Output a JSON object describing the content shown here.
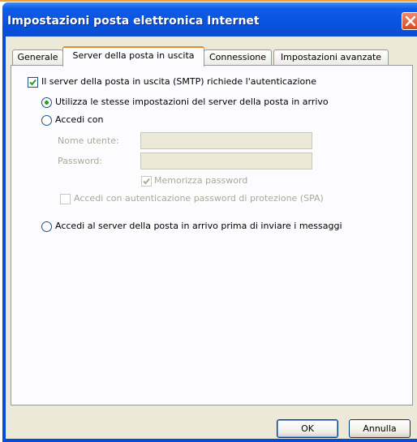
{
  "window": {
    "title": "Impostazioni posta elettronica Internet"
  },
  "tabs": [
    {
      "label": "Generale",
      "active": false
    },
    {
      "label": "Server della posta in uscita",
      "active": true
    },
    {
      "label": "Connessione",
      "active": false
    },
    {
      "label": "Impostazioni avanzate",
      "active": false
    }
  ],
  "outgoing": {
    "smtp_auth_label": "Il server della posta in uscita (SMTP) richiede l'autenticazione",
    "smtp_auth_checked": true,
    "same_settings_label": "Utilizza le stesse impostazioni del server della posta in arrivo",
    "same_settings_selected": true,
    "login_with_label": "Accedi con",
    "login_with_selected": false,
    "username_label": "Nome utente:",
    "username_value": "",
    "password_label": "Password:",
    "password_value": "",
    "remember_password_label": "Memorizza password",
    "remember_password_checked": true,
    "spa_label": "Accedi con autenticazione password di protezione (SPA)",
    "spa_checked": false,
    "login_before_label": "Accedi al server della posta in arrivo prima di inviare i messaggi",
    "login_before_selected": false
  },
  "buttons": {
    "ok": "OK",
    "cancel": "Annulla"
  },
  "colors": {
    "titlebar": "#0853e0",
    "client_bg": "#ece9d8",
    "active_tab_accent": "#e68b2c",
    "radio_dot": "#21a121",
    "close_button": "#d9471e"
  },
  "icons": {
    "close": "close-icon",
    "checkmark": "checkmark-icon"
  }
}
